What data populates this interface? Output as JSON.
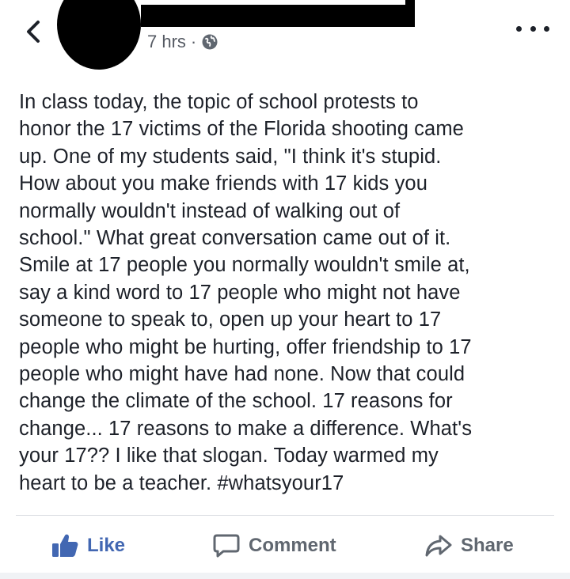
{
  "header": {
    "back_icon": "chevron-left-icon",
    "timestamp": "7 hrs",
    "separator": "·",
    "privacy_icon": "globe-icon",
    "more_icon": "more-horizontal-icon"
  },
  "post": {
    "text": "In class today, the topic of school protests to\nhonor the 17 victims of the Florida shooting came\nup.  One of my students said, \"I think it's stupid.\nHow about you make friends with 17 kids you\nnormally wouldn't instead of walking out of\nschool.\"  What great conversation came out of it.\nSmile at 17 people you normally wouldn't smile at,\nsay a kind word to 17 people who might not have\nsomeone to speak to, open up your heart to 17\npeople who might be hurting, offer friendship to 17\npeople who might have had none.  Now that could\nchange the climate of the school.  17 reasons for\nchange... 17 reasons to make a difference.  What's\nyour 17?? I like that slogan.  Today warmed my\nheart to be a teacher. #whatsyour17"
  },
  "actions": {
    "like_label": "Like",
    "comment_label": "Comment",
    "share_label": "Share"
  },
  "colors": {
    "like_active": "#4267b2",
    "action_gray": "#606770",
    "text": "#1d2129",
    "meta_gray": "#555a63",
    "divider": "#dadde1"
  }
}
